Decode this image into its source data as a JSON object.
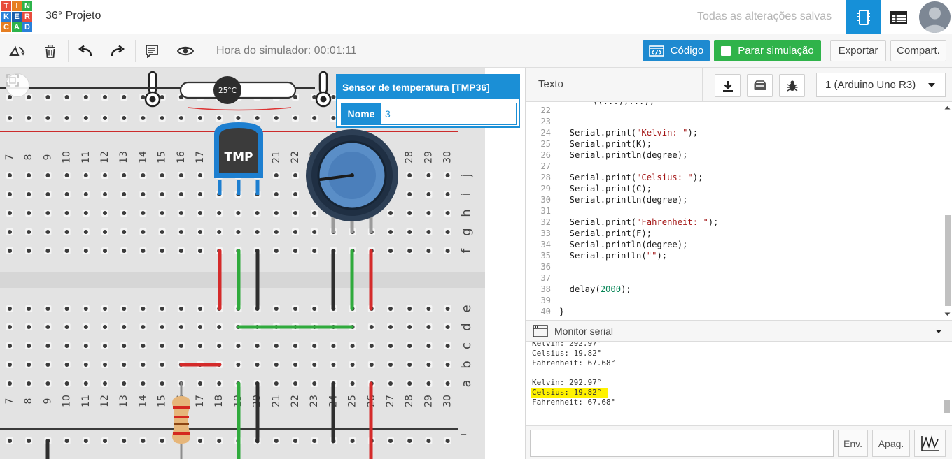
{
  "logo": {
    "letters": [
      "T",
      "I",
      "N",
      "K",
      "E",
      "R",
      "C",
      "A",
      "D"
    ],
    "colors": [
      "#e74c3c",
      "#e67e22",
      "#2db34a",
      "#2980d9",
      "#1a5eab",
      "#e74c3c",
      "#e67e22",
      "#2db34a",
      "#2980d9"
    ]
  },
  "header": {
    "project_name": "36° Projeto",
    "save_status": "Todas as alterações salvas"
  },
  "toolbar": {
    "simulator_time": "Hora do simulador: 00:01:11",
    "code_label": "Código",
    "stop_sim_label": "Parar simulação",
    "export_label": "Exportar",
    "share_label": "Compart."
  },
  "canvas": {
    "temperature_badge": "25°C",
    "component_label": "TMP",
    "row_labels_right": [
      "j",
      "i",
      "h",
      "g",
      "f",
      "e",
      "d",
      "c",
      "b",
      "a"
    ],
    "column_numbers": [
      "7",
      "8",
      "9",
      "10",
      "11",
      "12",
      "13",
      "14",
      "15",
      "16",
      "17",
      "18",
      "19",
      "20",
      "21",
      "22",
      "23",
      "24",
      "25",
      "26",
      "27",
      "28",
      "29",
      "30"
    ],
    "top_columns_visible": [
      "7",
      "8",
      "9",
      "10",
      "11",
      "12",
      "13",
      "14",
      "15",
      "16",
      "17",
      "18",
      "19",
      "20",
      "21",
      "22",
      "23",
      "24",
      "25",
      "26",
      "27",
      "28",
      "29",
      "30"
    ],
    "minus_sign": "–"
  },
  "inspector": {
    "title": "Sensor de temperatura [TMP36]",
    "name_label": "Nome",
    "name_value": "3"
  },
  "code_panel": {
    "mode": "Texto",
    "device": "1 (Arduino Uno R3)",
    "lines": [
      {
        "n": "22",
        "code": ""
      },
      {
        "n": "23",
        "code": ""
      },
      {
        "n": "24",
        "pre": "  Serial.print(",
        "str": "\"Kelvin: \"",
        "post": ");"
      },
      {
        "n": "25",
        "code": "  Serial.print(K);"
      },
      {
        "n": "26",
        "code": "  Serial.println(degree);"
      },
      {
        "n": "27",
        "code": ""
      },
      {
        "n": "28",
        "pre": "  Serial.print(",
        "str": "\"Celsius: \"",
        "post": ");"
      },
      {
        "n": "29",
        "code": "  Serial.print(C);"
      },
      {
        "n": "30",
        "code": "  Serial.println(degree);"
      },
      {
        "n": "31",
        "code": ""
      },
      {
        "n": "32",
        "pre": "  Serial.print(",
        "str": "\"Fahrenheit: \"",
        "post": ");"
      },
      {
        "n": "33",
        "code": "  Serial.print(F);"
      },
      {
        "n": "34",
        "code": "  Serial.println(degree);"
      },
      {
        "n": "35",
        "pre": "  Serial.println(",
        "str": "\"\"",
        "post": ");"
      },
      {
        "n": "36",
        "code": ""
      },
      {
        "n": "37",
        "code": ""
      },
      {
        "n": "38",
        "pre": "  delay(",
        "num": "2000",
        "post": ");"
      },
      {
        "n": "39",
        "code": ""
      },
      {
        "n": "40",
        "code": "}"
      }
    ]
  },
  "serial": {
    "title": "Monitor serial",
    "lines": [
      "Kelvin: 292.97°",
      "Celsius: 19.82°",
      "Fahrenheit: 67.68°",
      "",
      "Kelvin: 292.97°",
      "Celsius: 19.82°",
      "Fahrenheit: 67.68°"
    ],
    "highlighted_line": "Celsius: 19.82°",
    "send_label": "Env.",
    "clear_label": "Apag."
  }
}
